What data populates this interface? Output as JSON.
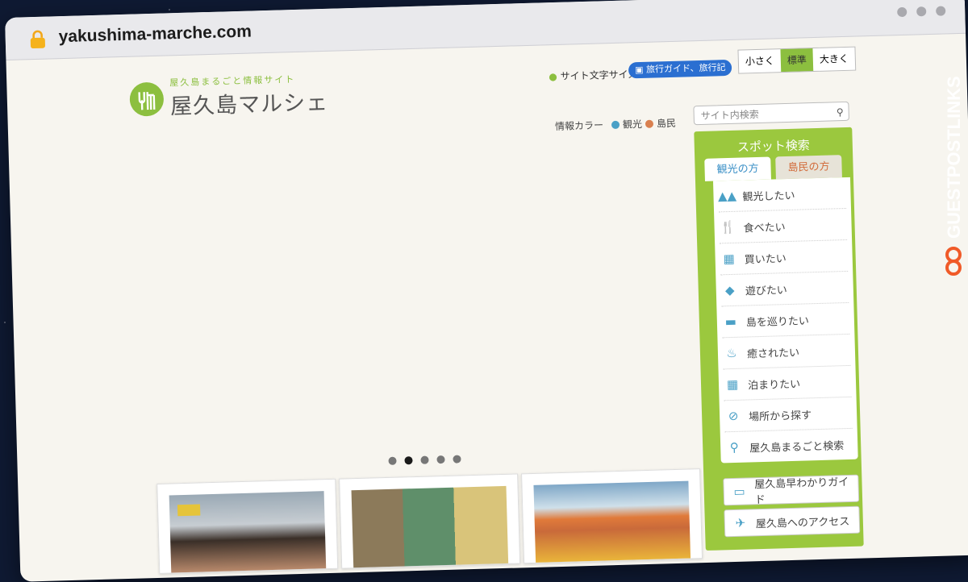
{
  "browser": {
    "url": "yakushima-marche.com"
  },
  "header": {
    "logo_sub": "屋久島まるごと情報サイト",
    "logo_main": "屋久島マルシェ",
    "site_text": "サイト文字サイズ",
    "guide_button": "旅行ガイド、旅行記",
    "font_sizes": [
      "小さく",
      "標準",
      "大きく"
    ],
    "info_color_label": "情報カラー",
    "info_colors": [
      {
        "label": "観光",
        "color": "#4aa0c6"
      },
      {
        "label": "島民",
        "color": "#d9804f"
      }
    ],
    "search_placeholder": "サイト内検索"
  },
  "spot_search": {
    "title": "スポット検索",
    "tabs": [
      "観光の方",
      "島民の方"
    ],
    "items": [
      {
        "label": "観光したい",
        "icon": "mountain-icon"
      },
      {
        "label": "食べたい",
        "icon": "fork-knife-icon"
      },
      {
        "label": "買いたい",
        "icon": "basket-icon"
      },
      {
        "label": "遊びたい",
        "icon": "fish-icon"
      },
      {
        "label": "島を巡りたい",
        "icon": "car-icon"
      },
      {
        "label": "癒されたい",
        "icon": "hot-spring-icon"
      },
      {
        "label": "泊まりたい",
        "icon": "building-icon"
      },
      {
        "label": "場所から探す",
        "icon": "compass-icon"
      },
      {
        "label": "屋久島まるごと検索",
        "icon": "pin-icon"
      }
    ],
    "extra_buttons": [
      {
        "label": "屋久島早わかりガイド",
        "icon": "book-icon"
      },
      {
        "label": "屋久島へのアクセス",
        "icon": "plane-icon"
      }
    ]
  },
  "slider": {
    "count": 5,
    "active": 2
  },
  "watermark": "GUESTPOSTLINKS",
  "colors": {
    "accent": "#8cbf3f",
    "tourist": "#4aa0c6",
    "resident": "#d9804f"
  }
}
